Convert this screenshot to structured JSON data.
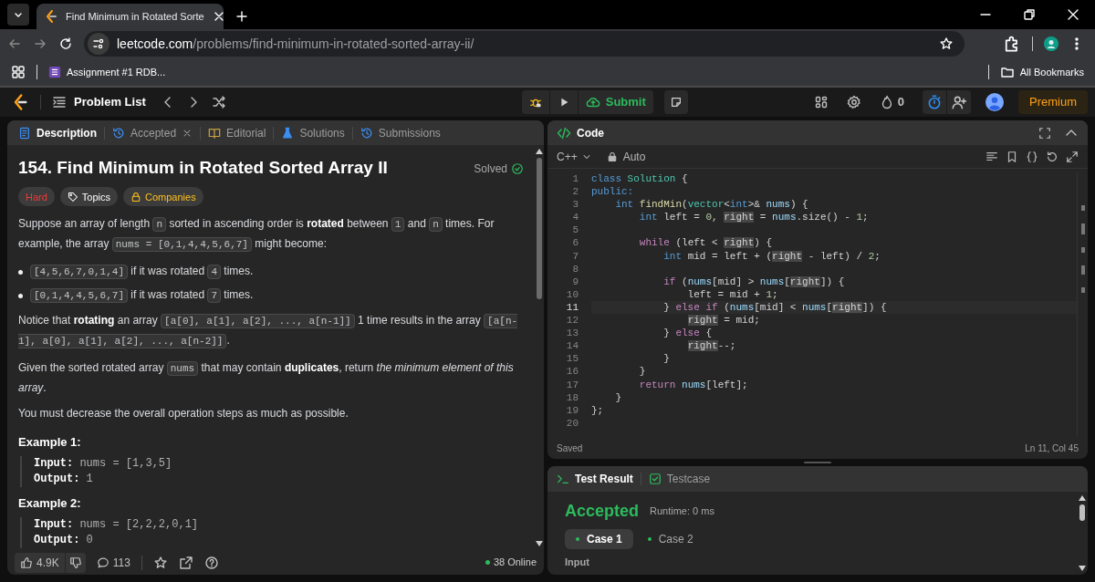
{
  "browser": {
    "tab_title": "Find Minimum in Rotated Sorte",
    "url_host": "leetcode.com",
    "url_path": "/problems/find-minimum-in-rotated-sorted-array-ii/",
    "bookmarks": [
      "Assignment #1 RDB..."
    ],
    "all_bookmarks": "All Bookmarks"
  },
  "nav": {
    "problem_list": "Problem List",
    "submit": "Submit",
    "streak": "0",
    "premium": "Premium"
  },
  "description_tabs": [
    {
      "label": "Description",
      "kind": "description",
      "selected": true,
      "closable": false
    },
    {
      "label": "Accepted",
      "kind": "accepted",
      "selected": false,
      "closable": true
    },
    {
      "label": "Editorial",
      "kind": "editorial",
      "selected": false,
      "closable": false
    },
    {
      "label": "Solutions",
      "kind": "solutions",
      "selected": false,
      "closable": false
    },
    {
      "label": "Submissions",
      "kind": "submissions",
      "selected": false,
      "closable": false
    }
  ],
  "problem": {
    "title": "154. Find Minimum in Rotated Sorted Array II",
    "status": "Solved",
    "tags": [
      {
        "label": "Hard",
        "kind": "difficulty"
      },
      {
        "label": "Topics",
        "kind": "topics"
      },
      {
        "label": "Companies",
        "kind": "companies"
      }
    ],
    "paragraphs": [
      [
        {
          "text": "Suppose an array of length ",
          "kind": "text"
        },
        {
          "text": "n",
          "kind": "code"
        },
        {
          "text": " sorted in ascending order is ",
          "kind": "text"
        },
        {
          "text": "rotated",
          "kind": "bold"
        },
        {
          "text": " between ",
          "kind": "text"
        },
        {
          "text": "1",
          "kind": "code"
        },
        {
          "text": " and ",
          "kind": "text"
        },
        {
          "text": "n",
          "kind": "code"
        },
        {
          "text": " times. For example, the array ",
          "kind": "text"
        },
        {
          "text": "nums = [0,1,4,4,5,6,7]",
          "kind": "code"
        },
        {
          "text": " might become:",
          "kind": "text"
        }
      ]
    ],
    "bullets": [
      [
        {
          "text": "[4,5,6,7,0,1,4]",
          "kind": "code"
        },
        {
          "text": " if it was rotated ",
          "kind": "text"
        },
        {
          "text": "4",
          "kind": "code"
        },
        {
          "text": " times.",
          "kind": "text"
        }
      ],
      [
        {
          "text": "[0,1,4,4,5,6,7]",
          "kind": "code"
        },
        {
          "text": " if it was rotated ",
          "kind": "text"
        },
        {
          "text": "7",
          "kind": "code"
        },
        {
          "text": " times.",
          "kind": "text"
        }
      ]
    ],
    "notes": [
      [
        {
          "text": "Notice that ",
          "kind": "text"
        },
        {
          "text": "rotating",
          "kind": "bold"
        },
        {
          "text": " an array ",
          "kind": "text"
        },
        {
          "text": "[a[0], a[1], a[2], ..., a[n-1]]",
          "kind": "code"
        },
        {
          "text": " 1 time results in the array ",
          "kind": "text"
        },
        {
          "text": "[a[n-1], a[0], a[1], a[2], ..., a[n-2]]",
          "kind": "code"
        },
        {
          "text": ".",
          "kind": "text"
        }
      ],
      [
        {
          "text": "Given the sorted rotated array ",
          "kind": "text"
        },
        {
          "text": "nums",
          "kind": "code"
        },
        {
          "text": " that may contain ",
          "kind": "text"
        },
        {
          "text": "duplicates",
          "kind": "bold"
        },
        {
          "text": ", return ",
          "kind": "text"
        },
        {
          "text": "the minimum element of this array",
          "kind": "italic"
        },
        {
          "text": ".",
          "kind": "text"
        }
      ],
      [
        {
          "text": "You must decrease the overall operation steps as much as possible.",
          "kind": "text"
        }
      ]
    ],
    "examples": [
      {
        "title": "Example 1:",
        "lines": [
          {
            "label": "Input:",
            "value": "nums = [1,3,5]"
          },
          {
            "label": "Output:",
            "value": "1"
          }
        ]
      },
      {
        "title": "Example 2:",
        "lines": [
          {
            "label": "Input:",
            "value": "nums = [2,2,2,0,1]"
          },
          {
            "label": "Output:",
            "value": "0"
          }
        ]
      }
    ]
  },
  "footer": {
    "likes": "4.9K",
    "comments": "113",
    "online": "38 Online"
  },
  "code": {
    "title": "Code",
    "language": "C++",
    "mode": "Auto",
    "status": "Saved",
    "cursor": "Ln 11, Col 45",
    "lines": [
      {
        "number": "1",
        "current": false,
        "tokens": [
          {
            "text": "class ",
            "kind": "keyword"
          },
          {
            "text": "Solution",
            "kind": "type"
          },
          {
            "text": " {",
            "kind": "plain"
          }
        ]
      },
      {
        "number": "2",
        "current": false,
        "tokens": [
          {
            "text": "public:",
            "kind": "keyword"
          }
        ]
      },
      {
        "number": "3",
        "current": false,
        "tokens": [
          {
            "text": "    int ",
            "kind": "keyword"
          },
          {
            "text": "findMin",
            "kind": "function"
          },
          {
            "text": "(",
            "kind": "plain"
          },
          {
            "text": "vector",
            "kind": "type"
          },
          {
            "text": "<",
            "kind": "plain"
          },
          {
            "text": "int",
            "kind": "keyword"
          },
          {
            "text": ">& ",
            "kind": "plain"
          },
          {
            "text": "nums",
            "kind": "variable"
          },
          {
            "text": ") {",
            "kind": "plain"
          }
        ]
      },
      {
        "number": "4",
        "current": false,
        "tokens": [
          {
            "text": "        int",
            "kind": "keyword"
          },
          {
            "text": " left = ",
            "kind": "plain"
          },
          {
            "text": "0",
            "kind": "number"
          },
          {
            "text": ", ",
            "kind": "plain"
          },
          {
            "text": "right",
            "kind": "highlight"
          },
          {
            "text": " = ",
            "kind": "plain"
          },
          {
            "text": "nums",
            "kind": "variable"
          },
          {
            "text": ".size() - ",
            "kind": "plain"
          },
          {
            "text": "1",
            "kind": "number"
          },
          {
            "text": ";",
            "kind": "plain"
          }
        ]
      },
      {
        "number": "5",
        "current": false
      },
      {
        "number": "6",
        "current": false,
        "tokens": [
          {
            "text": "        while",
            "kind": "control"
          },
          {
            "text": " (left < ",
            "kind": "plain"
          },
          {
            "text": "right",
            "kind": "highlight"
          },
          {
            "text": ") {",
            "kind": "plain"
          }
        ]
      },
      {
        "number": "7",
        "current": false,
        "tokens": [
          {
            "text": "            int",
            "kind": "keyword"
          },
          {
            "text": " mid = left + (",
            "kind": "plain"
          },
          {
            "text": "right",
            "kind": "highlight"
          },
          {
            "text": " - left) / ",
            "kind": "plain"
          },
          {
            "text": "2",
            "kind": "number"
          },
          {
            "text": ";",
            "kind": "plain"
          }
        ]
      },
      {
        "number": "8",
        "current": false
      },
      {
        "number": "9",
        "current": false,
        "tokens": [
          {
            "text": "            if",
            "kind": "control"
          },
          {
            "text": " (",
            "kind": "plain"
          },
          {
            "text": "nums",
            "kind": "variable"
          },
          {
            "text": "[mid] > ",
            "kind": "plain"
          },
          {
            "text": "nums",
            "kind": "variable"
          },
          {
            "text": "[",
            "kind": "plain"
          },
          {
            "text": "right",
            "kind": "highlight"
          },
          {
            "text": "]) {",
            "kind": "plain"
          }
        ]
      },
      {
        "number": "10",
        "current": false,
        "tokens": [
          {
            "text": "                left = mid + ",
            "kind": "plain"
          },
          {
            "text": "1",
            "kind": "number"
          },
          {
            "text": ";",
            "kind": "plain"
          }
        ]
      },
      {
        "number": "11",
        "current": true,
        "tokens": [
          {
            "text": "            } ",
            "kind": "plain"
          },
          {
            "text": "else if",
            "kind": "control"
          },
          {
            "text": " (",
            "kind": "plain"
          },
          {
            "text": "nums",
            "kind": "variable"
          },
          {
            "text": "[mid] < ",
            "kind": "plain"
          },
          {
            "text": "nums",
            "kind": "variable"
          },
          {
            "text": "[",
            "kind": "plain"
          },
          {
            "text": "right",
            "kind": "highlight"
          },
          {
            "text": "]) {",
            "kind": "plain"
          }
        ]
      },
      {
        "number": "12",
        "current": false,
        "tokens": [
          {
            "text": "                right",
            "kind": "highlight"
          },
          {
            "text": " = mid;",
            "kind": "plain"
          }
        ]
      },
      {
        "number": "13",
        "current": false,
        "tokens": [
          {
            "text": "            } ",
            "kind": "plain"
          },
          {
            "text": "else",
            "kind": "control"
          },
          {
            "text": " {",
            "kind": "plain"
          }
        ]
      },
      {
        "number": "14",
        "current": false,
        "tokens": [
          {
            "text": "                right",
            "kind": "highlight"
          },
          {
            "text": "--;",
            "kind": "plain"
          }
        ]
      },
      {
        "number": "15",
        "current": false,
        "tokens": [
          {
            "text": "            }",
            "kind": "plain"
          }
        ]
      },
      {
        "number": "16",
        "current": false,
        "tokens": [
          {
            "text": "        }",
            "kind": "plain"
          }
        ]
      },
      {
        "number": "17",
        "current": false,
        "tokens": [
          {
            "text": "        return ",
            "kind": "control"
          },
          {
            "text": "nums",
            "kind": "variable"
          },
          {
            "text": "[left];",
            "kind": "plain"
          }
        ]
      },
      {
        "number": "18",
        "current": false,
        "tokens": [
          {
            "text": "    }",
            "kind": "plain"
          }
        ]
      },
      {
        "number": "19",
        "current": false,
        "tokens": [
          {
            "text": "};",
            "kind": "plain"
          }
        ]
      },
      {
        "number": "20",
        "current": false
      }
    ]
  },
  "test_result": {
    "tabs": [
      {
        "label": "Test Result",
        "kind": "result",
        "selected": true
      },
      {
        "label": "Testcase",
        "kind": "testcase",
        "selected": false
      }
    ],
    "verdict": "Accepted",
    "runtime": "Runtime: 0 ms",
    "cases": [
      {
        "label": "Case 1",
        "selected": true
      },
      {
        "label": "Case 2",
        "selected": false
      }
    ],
    "input_label": "Input"
  }
}
